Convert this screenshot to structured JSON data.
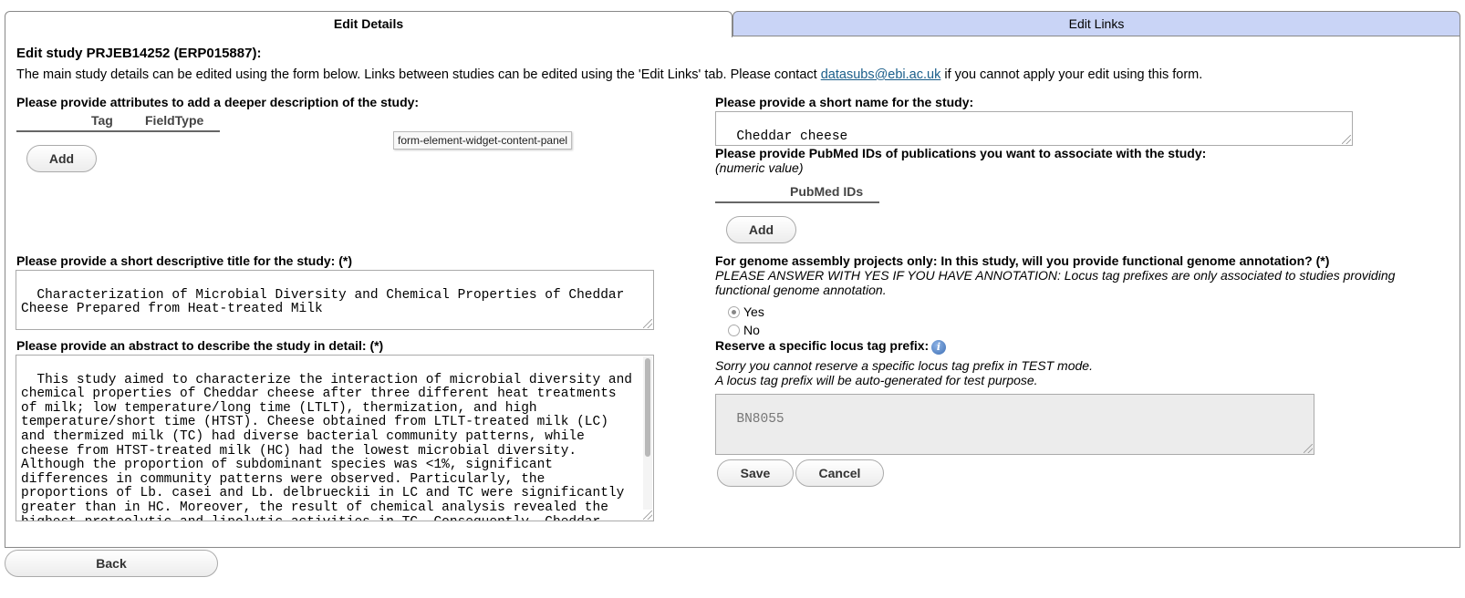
{
  "tabs": [
    {
      "label": "Edit Details"
    },
    {
      "label": "Edit Links"
    }
  ],
  "header": {
    "title": "Edit study PRJEB14252 (ERP015887):",
    "intro_before": "The main study details can be edited using the form below. Links between studies can be edited using the 'Edit Links' tab. Please contact ",
    "email": "datasubs@ebi.ac.uk",
    "intro_after": " if you cannot apply your edit using this form."
  },
  "attributes": {
    "label": "Please provide attributes to add a deeper description of the study:",
    "columns": [
      "Tag",
      "FieldType"
    ],
    "add_label": "Add",
    "tooltip": "form-element-widget-content-panel"
  },
  "title_field": {
    "label": "Please provide a short descriptive title for the study: (*)",
    "value": "Characterization of Microbial Diversity and Chemical Properties of Cheddar Cheese Prepared from Heat-treated Milk"
  },
  "abstract_field": {
    "label": "Please provide an abstract to describe the study in detail: (*)",
    "value": "This study aimed to characterize the interaction of microbial diversity and chemical properties of Cheddar cheese after three different heat treatments of milk; low temperature/long time (LTLT), thermization, and high temperature/short time (HTST). Cheese obtained from LTLT-treated milk (LC) and thermized milk (TC) had diverse bacterial community patterns, while cheese from HTST-treated milk (HC) had the lowest microbial diversity. Although the proportion of subdominant species was <1%, significant differences in community patterns were observed. Particularly, the proportions of Lb. casei and Lb. delbrueckii in LC and TC were significantly greater than in HC. Moreover, the result of chemical analysis revealed the highest proteolytic and lipolytic activities in TC. Consequently, Cheddar cheese was characterized"
  },
  "short_name": {
    "label": "Please provide a short name for the study:",
    "value": "Cheddar cheese"
  },
  "pubmed": {
    "label": "Please provide PubMed IDs of publications you want to associate with the study:",
    "hint": "(numeric value)",
    "column": "PubMed IDs",
    "add_label": "Add"
  },
  "annotation": {
    "question": "For genome assembly projects only: In this study, will you provide functional genome annotation? (*)",
    "note": "PLEASE ANSWER WITH YES IF YOU HAVE ANNOTATION: Locus tag prefixes are only associated to studies providing functional genome annotation.",
    "options": [
      {
        "label": "Yes",
        "checked": true
      },
      {
        "label": "No",
        "checked": false
      }
    ]
  },
  "locus_tag": {
    "label": "Reserve a specific locus tag prefix:",
    "note1": "Sorry you cannot reserve a specific locus tag prefix in TEST mode.",
    "note2": "A locus tag prefix will be auto-generated for test purpose.",
    "value": "BN8055"
  },
  "actions": {
    "save_label": "Save",
    "cancel_label": "Cancel",
    "back_label": "Back"
  },
  "colors": {
    "inactive_tab": "#c9d4f6",
    "link": "#1a5e8a"
  }
}
